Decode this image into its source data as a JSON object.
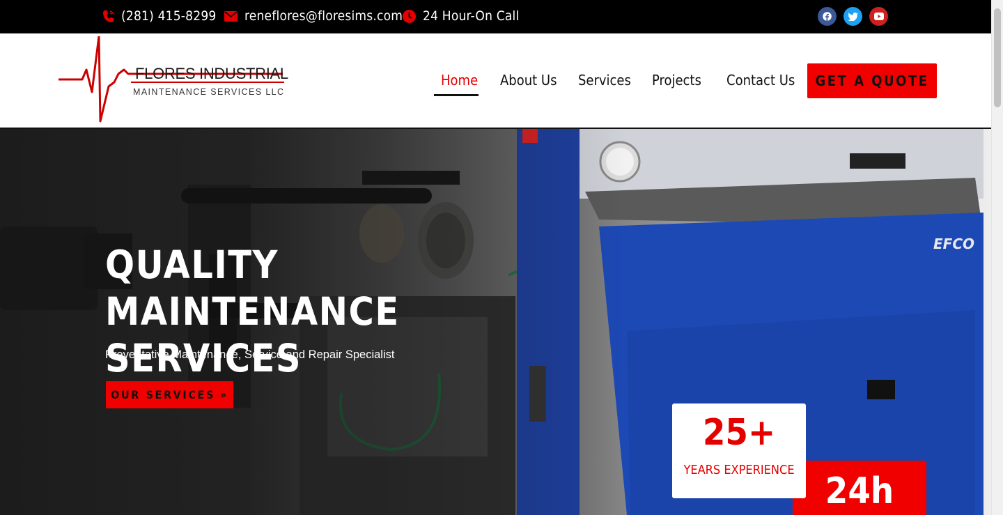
{
  "topbar": {
    "phone": "(281) 415-8299",
    "email": "reneflores@floresims.com",
    "hours": "24 Hour-On Call",
    "social": [
      {
        "name": "facebook",
        "color": "#3b5998"
      },
      {
        "name": "twitter",
        "color": "#1da1f2"
      },
      {
        "name": "youtube",
        "color": "#cd201f"
      }
    ]
  },
  "logo": {
    "title": "FLORES INDUSTRIAL",
    "subtitle": "MAINTENANCE SERVICES LLC"
  },
  "nav": {
    "items": [
      {
        "label": "Home",
        "active": true
      },
      {
        "label": "About Us",
        "active": false
      },
      {
        "label": "Services",
        "active": false
      },
      {
        "label": "Projects",
        "active": false
      },
      {
        "label": "Contact Us",
        "active": false
      }
    ],
    "cta": "GET A QUOTE"
  },
  "hero": {
    "title_line1": "QUALITY MAINTENANCE",
    "title_line2": "SERVICES",
    "subtitle": "Preventative Maintenance, Service and Repair Specialist",
    "button": "OUR SERVICES",
    "button_icon": "»",
    "machine_brand": "EFCO"
  },
  "stats": [
    {
      "number": "25+",
      "label": "YEARS EXPERIENCE"
    },
    {
      "number": "24h"
    }
  ],
  "colors": {
    "accent": "#f10000",
    "dark": "#000000",
    "machine_blue": "#1d49b5"
  }
}
